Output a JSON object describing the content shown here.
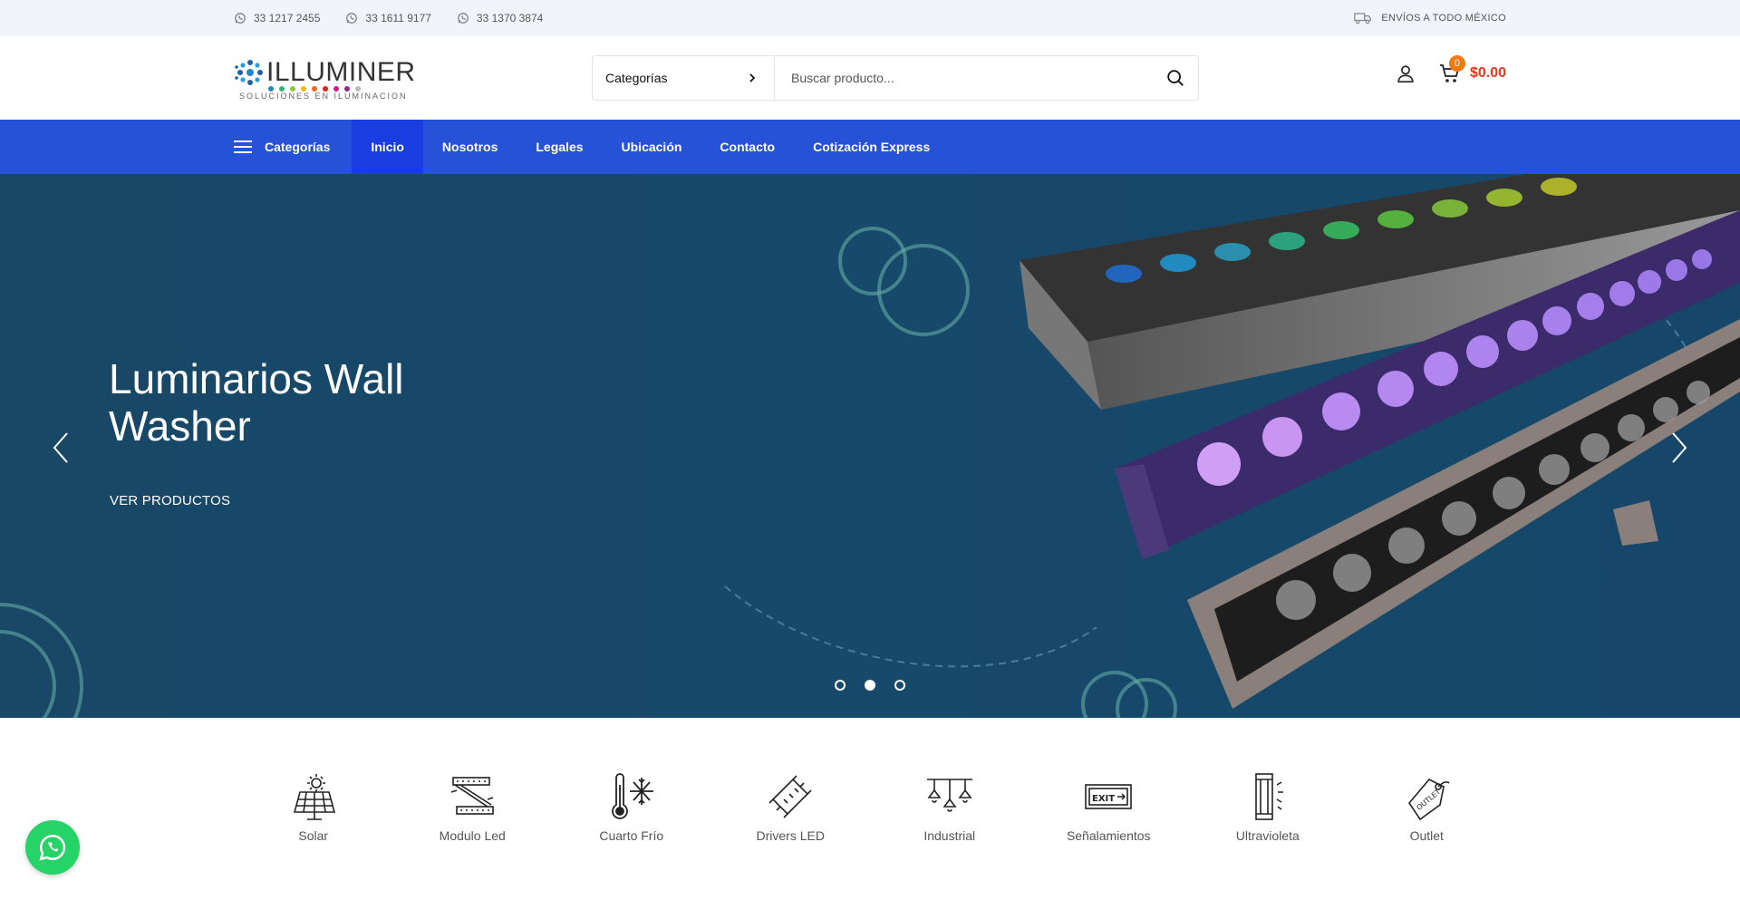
{
  "topbar": {
    "phones": [
      "33 1217 2455",
      "33 1611 9177",
      "33 1370 3874"
    ],
    "shipping": "ENVÍOS A TODO MÉXICO"
  },
  "logo": {
    "brand": "ILLUMINER",
    "tagline": "SOLUCIONES EN ILUMINACION"
  },
  "search": {
    "category_label": "Categorías",
    "placeholder": "Buscar producto..."
  },
  "cart": {
    "count": "0",
    "total": "$0.00"
  },
  "nav": {
    "categories_label": "Categorías",
    "items": [
      "Inicio",
      "Nosotros",
      "Legales",
      "Ubicación",
      "Contacto",
      "Cotización Express"
    ]
  },
  "hero": {
    "title": "Luminarios Wall Washer",
    "cta": "VER PRODUCTOS",
    "slides": 3,
    "active_slide": 2
  },
  "categories": [
    "Solar",
    "Modulo Led",
    "Cuarto Frío",
    "Drivers LED",
    "Industrial",
    "Señalamientos",
    "Ultravioleta",
    "Outlet"
  ],
  "icons": {
    "phone": "whatsapp-icon",
    "shipping": "truck-icon",
    "search": "search-icon",
    "account": "user-icon",
    "cart": "cart-icon",
    "menu": "hamburger-icon",
    "whatsapp_float": "whatsapp-icon"
  },
  "colors": {
    "topbar_bg": "#f1f4fa",
    "nav_bg": "#2552d6",
    "nav_active": "#1a3de0",
    "cart_total": "#e8361b",
    "cart_badge": "#f07a12",
    "whatsapp": "#25d366"
  }
}
